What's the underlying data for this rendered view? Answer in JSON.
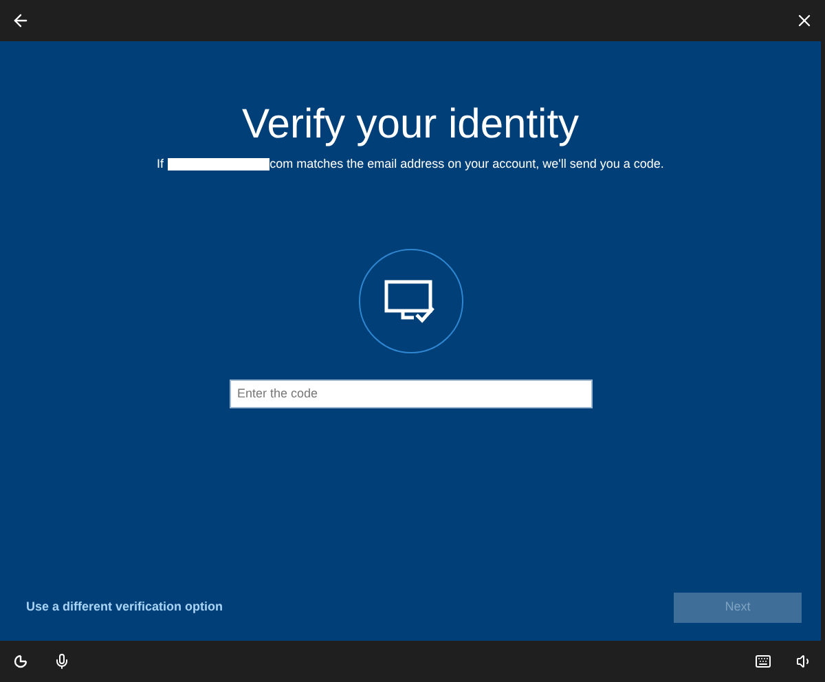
{
  "title": "Verify your identity",
  "subtitle": {
    "before": "If",
    "after": "com matches the email address on your account, we'll send you a code."
  },
  "code_field": {
    "placeholder": "Enter the code"
  },
  "alternate_link": "Use a different verification option",
  "next_button": {
    "label": "Next",
    "disabled": true
  }
}
